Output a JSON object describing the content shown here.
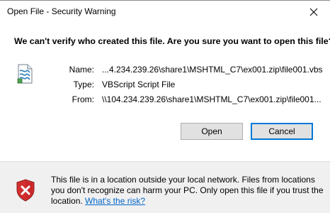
{
  "window": {
    "title": "Open File - Security Warning"
  },
  "dialog": {
    "question": "We can't verify who created this file. Are you sure you want to open this file?",
    "details": [
      {
        "label": "Name:",
        "value": "...4.234.239.26\\share1\\MSHTML_C7\\ex001.zip\\file001.vbs"
      },
      {
        "label": "Type:",
        "value": "VBScript Script File"
      },
      {
        "label": "From:",
        "value": "\\\\104.234.239.26\\share1\\MSHTML_C7\\ex001.zip\\file001..."
      }
    ],
    "buttons": {
      "open": "Open",
      "cancel": "Cancel"
    }
  },
  "footer": {
    "warning_text": "This file is in a location outside your local network. Files from locations you don't recognize can harm your PC. Only open this file if you trust the location.",
    "link_text": "What's the risk?"
  },
  "colors": {
    "link": "#0066cc",
    "shield_red": "#d32f2f",
    "button_focus": "#0078d7"
  },
  "icons": {
    "close": "close-icon",
    "file": "vbscript-file-icon",
    "shield": "security-shield-icon"
  }
}
